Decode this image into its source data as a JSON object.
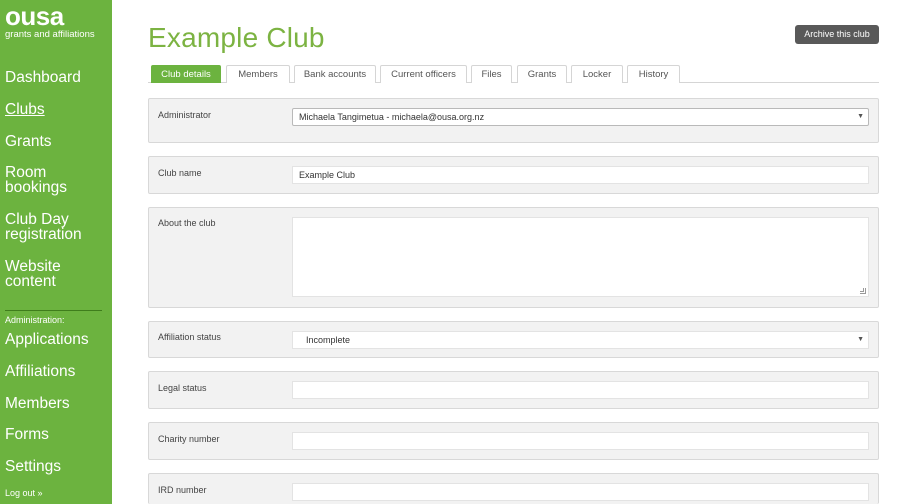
{
  "sidebar": {
    "logo": "ousa",
    "logo_sub": "grants and affiliations",
    "nav": [
      {
        "label": "Dashboard"
      },
      {
        "label": "Clubs"
      },
      {
        "label": "Grants"
      },
      {
        "label": "Room bookings"
      },
      {
        "label": "Club Day registration"
      },
      {
        "label": "Website content"
      }
    ],
    "admin_label": "Administration:",
    "admin_nav": [
      {
        "label": "Applications"
      },
      {
        "label": "Affiliations"
      },
      {
        "label": "Members"
      },
      {
        "label": "Forms"
      },
      {
        "label": "Settings"
      }
    ],
    "logout": "Log out »"
  },
  "main": {
    "title": "Example Club",
    "archive_label": "Archive this club",
    "tabs": [
      {
        "label": "Club details"
      },
      {
        "label": "Members"
      },
      {
        "label": "Bank accounts"
      },
      {
        "label": "Current officers"
      },
      {
        "label": "Files"
      },
      {
        "label": "Grants"
      },
      {
        "label": "Locker"
      },
      {
        "label": "History"
      }
    ],
    "fields": {
      "administrator": {
        "label": "Administrator",
        "value": "Michaela Tangimetua - michaela@ousa.org.nz"
      },
      "club_name": {
        "label": "Club name",
        "value": "Example Club"
      },
      "about": {
        "label": "About the club",
        "value": ""
      },
      "affiliation_status": {
        "label": "Affiliation status",
        "value": "Incomplete"
      },
      "legal_status": {
        "label": "Legal status",
        "value": ""
      },
      "charity_number": {
        "label": "Charity number",
        "value": ""
      },
      "ird_number": {
        "label": "IRD number",
        "value": ""
      }
    }
  },
  "colors": {
    "brand": "#6cb33f",
    "title": "#7cb342",
    "button_dark": "#595959"
  }
}
